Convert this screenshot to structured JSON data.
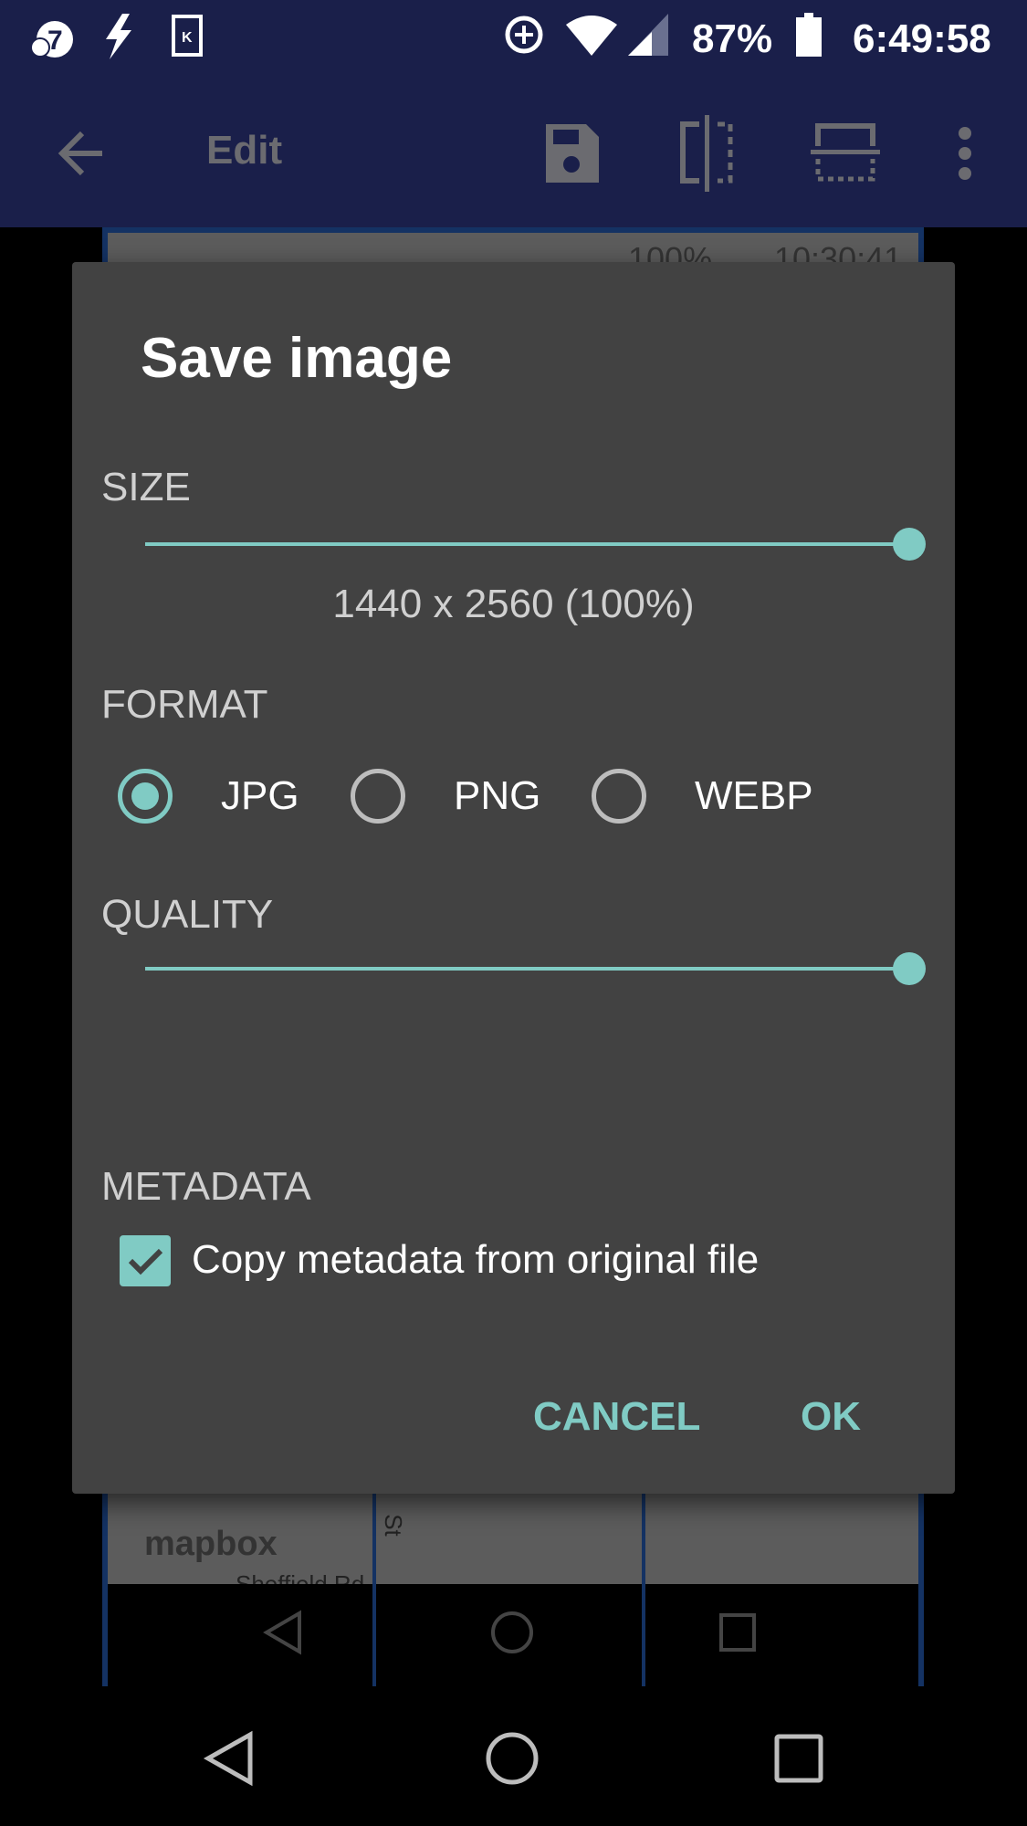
{
  "status_bar": {
    "icons": [
      "abc7-icon",
      "flash-icon",
      "k-app-icon",
      "data-saver-icon",
      "wifi-icon",
      "signal-icon",
      "battery-icon"
    ],
    "battery": "87%",
    "time": "6:49:58"
  },
  "toolbar": {
    "title": "Edit",
    "icons": [
      "back-arrow-icon",
      "save-icon",
      "flip-horizontal-icon",
      "flip-vertical-icon",
      "more-vert-icon"
    ]
  },
  "background": {
    "map_labels": [
      "mapbox",
      "Sheffield Rd",
      "St"
    ],
    "inner_status_battery": "100%",
    "inner_status_time": "10:30:41"
  },
  "dialog": {
    "title": "Save image",
    "size": {
      "label": "SIZE",
      "value_percent": 100,
      "readout": "1440 x 2560 (100%)"
    },
    "format": {
      "label": "FORMAT",
      "options": [
        "JPG",
        "PNG",
        "WEBP"
      ],
      "selected": "JPG"
    },
    "quality": {
      "label": "QUALITY",
      "value_percent": 100
    },
    "metadata": {
      "label": "METADATA",
      "checkbox_label": "Copy metadata from original file",
      "checked": true
    },
    "buttons": {
      "cancel": "CANCEL",
      "ok": "OK"
    }
  },
  "colors": {
    "accent": "#80cbc4",
    "appbar": "#1a1f4a",
    "dialog": "#424242"
  }
}
